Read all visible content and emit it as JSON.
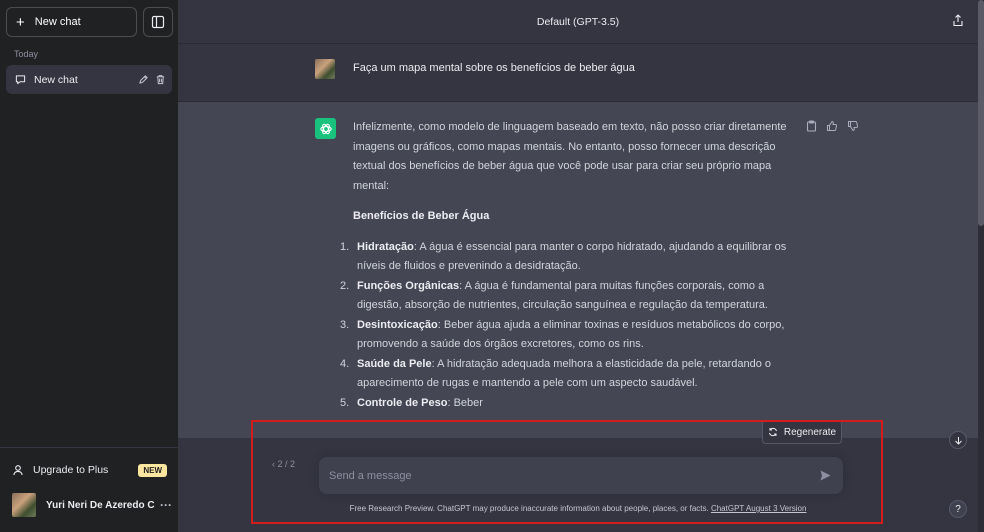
{
  "sidebar": {
    "new_chat_label": "New chat",
    "section_label": "Today",
    "chat_items": [
      {
        "label": "New chat"
      }
    ],
    "upgrade_label": "Upgrade to Plus",
    "upgrade_badge": "NEW",
    "user_name": "Yuri Neri De Azeredo C",
    "more_label": "···"
  },
  "header": {
    "title": "Default (GPT-3.5)"
  },
  "conversation": {
    "user_message": "Faça um mapa mental sobre os benefícios de beber água",
    "assistant_intro": "Infelizmente, como modelo de linguagem baseado em texto, não posso criar diretamente imagens ou gráficos, como mapas mentais. No entanto, posso fornecer uma descrição textual dos benefícios de beber água que você pode usar para criar seu próprio mapa mental:",
    "assistant_heading": "Benefícios de Beber Água",
    "list": [
      {
        "num": "1.",
        "title": "Hidratação",
        "text": ": A água é essencial para manter o corpo hidratado, ajudando a equilibrar os níveis de fluidos e prevenindo a desidratação."
      },
      {
        "num": "2.",
        "title": "Funções Orgânicas",
        "text": ": A água é fundamental para muitas funções corporais, como a digestão, absorção de nutrientes, circulação sanguínea e regulação da temperatura."
      },
      {
        "num": "3.",
        "title": "Desintoxicação",
        "text": ": Beber água ajuda a eliminar toxinas e resíduos metabólicos do corpo, promovendo a saúde dos órgãos excretores, como os rins."
      },
      {
        "num": "4.",
        "title": "Saúde da Pele",
        "text": ": A hidratação adequada melhora a elasticidade da pele, retardando o aparecimento de rugas e mantendo a pele com um aspecto saudável."
      },
      {
        "num": "5.",
        "title": "Controle de Peso",
        "text": ": Beber"
      }
    ]
  },
  "composer": {
    "regenerate_label": "Regenerate",
    "pager": "‹ 2 / 2",
    "placeholder": "Send a message",
    "disclaimer_text": "Free Research Preview. ChatGPT may produce inaccurate information about people, places, or facts. ",
    "disclaimer_link": "ChatGPT August 3 Version"
  },
  "help_label": "?",
  "icons": {
    "new_chat": "plus-icon",
    "toggle_sidebar": "sidebar-toggle-icon",
    "chat": "chat-bubble-icon",
    "edit": "pencil-icon",
    "delete": "trash-icon",
    "upgrade": "user-icon",
    "share": "share-icon",
    "copy": "clipboard-icon",
    "thumbs_up": "thumbs-up-icon",
    "thumbs_down": "thumbs-down-icon",
    "regenerate": "refresh-icon",
    "send": "send-icon",
    "scroll_down": "arrow-down-icon"
  },
  "colors": {
    "sidebar_bg": "#202123",
    "main_bg": "#343541",
    "assistant_bg": "#444654",
    "gpt_green": "#19c37d",
    "badge_bg": "#fae69e",
    "highlight": "#d31d1d"
  }
}
